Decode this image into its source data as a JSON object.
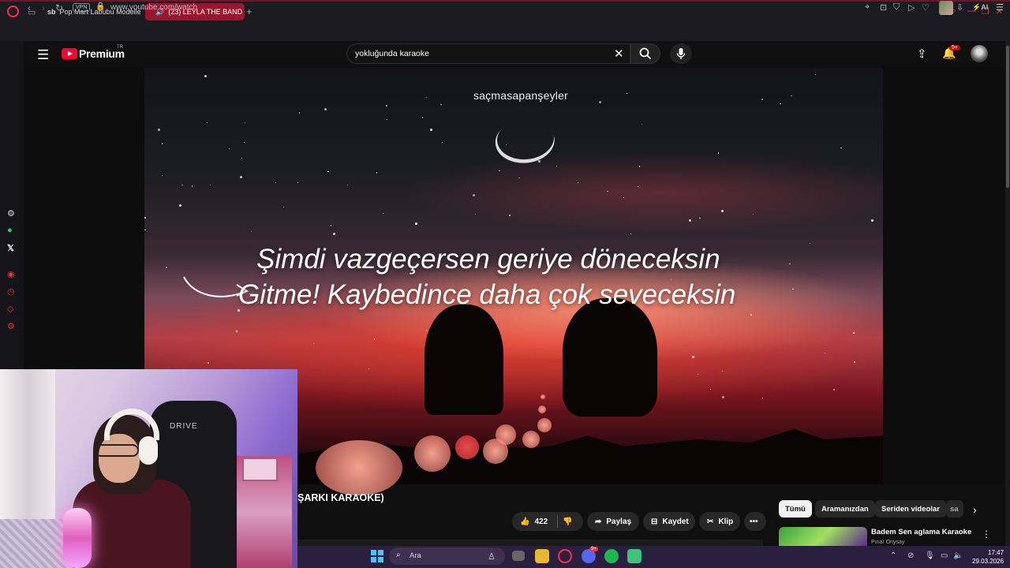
{
  "browser": {
    "tabs": [
      {
        "favicon": "sb",
        "label": "Pop Mart Labubu Modelle",
        "active": false
      },
      {
        "favicon": "play",
        "label": "(23) LEYLA THE BAND",
        "active": true
      }
    ],
    "url": "www.youtube.com/watch",
    "vpn_label": "VPN",
    "ai_label": "AI",
    "accent": "#ff2d46"
  },
  "youtube": {
    "logo_text": "Premium",
    "region": "TR",
    "search_value": "yokluğunda karaoke",
    "notification_count": "9+",
    "video": {
      "channel_watermark": "saçmasapanşeyler",
      "lyric_line_1": "Şimdi vazgeçersen geriye döneceksin",
      "lyric_line_2": "Gitme! Kaybedince daha çok seveceksin"
    },
    "title_fragment": "ŞARKI KARAOKE)",
    "actions": {
      "likes": "422",
      "share": "Paylaş",
      "save": "Kaydet",
      "clip": "Klip"
    },
    "chips": [
      "Tümü",
      "Aramanızdan",
      "Seriden videolar",
      "sa"
    ],
    "recommendation": {
      "title": "Badem   Sen aglama Karaoke",
      "channel": "Pınar Onysay"
    }
  },
  "webcam": {
    "chair_brand": "DRIVE"
  },
  "taskbar": {
    "search_placeholder": "Ara",
    "discord_badge": "9+",
    "time": "17:47",
    "date": "29.03.2026"
  }
}
